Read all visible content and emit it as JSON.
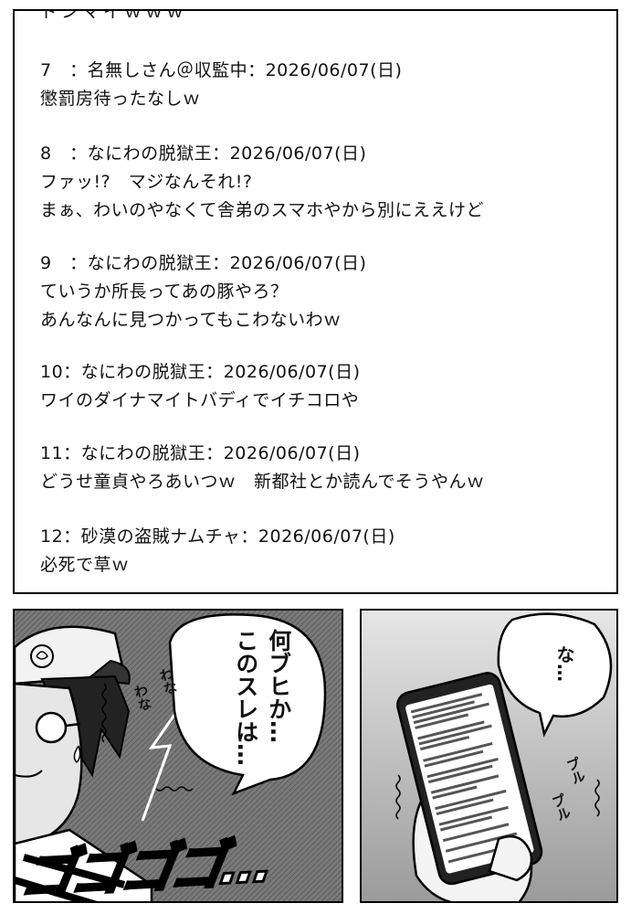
{
  "thread": {
    "cut_line": "ドンマイｗｗｗ",
    "posts": [
      {
        "header": "7　：名無しさん＠収監中：2026/06/07(日)",
        "lines": [
          "懲罰房待ったなしｗ"
        ]
      },
      {
        "header": "8　：なにわの脱獄王：2026/06/07(日)",
        "lines": [
          "ファッ!?　マジなんそれ!?",
          "まぁ、わいのやなくて舎弟のスマホやから別にええけど"
        ]
      },
      {
        "header": "9　：なにわの脱獄王：2026/06/07(日)",
        "lines": [
          "ていうか所長ってあの豚やろ？",
          "あんなんに見つかってもこわないわｗ"
        ]
      },
      {
        "header": "10：なにわの脱獄王：2026/06/07(日)",
        "lines": [
          "ワイのダイナマイトバディでイチコロや"
        ]
      },
      {
        "header": "11：なにわの脱獄王：2026/06/07(日)",
        "lines": [
          "どうせ童貞やろあいつｗ　新都社とか読んでそうやんｗ"
        ]
      },
      {
        "header": "12：砂漠の盗賊ナムチャ：2026/06/07(日)",
        "lines": [
          "必死で草ｗ"
        ]
      }
    ]
  },
  "panel_left": {
    "speech_col1": "何ブヒか…",
    "speech_col2": "このスレは…",
    "sfx_wana1": "わな",
    "sfx_wana2": "わな",
    "sfx_gogogo": "ゴゴゴゴ…"
  },
  "panel_right": {
    "speech": "な…",
    "sfx_puru1": "プル",
    "sfx_puru2": "プル"
  },
  "colors": {
    "ink": "#000000",
    "paper": "#ffffff",
    "screentone_dark": "#8c8c8c",
    "screentone_light": "#c7c7c7"
  }
}
